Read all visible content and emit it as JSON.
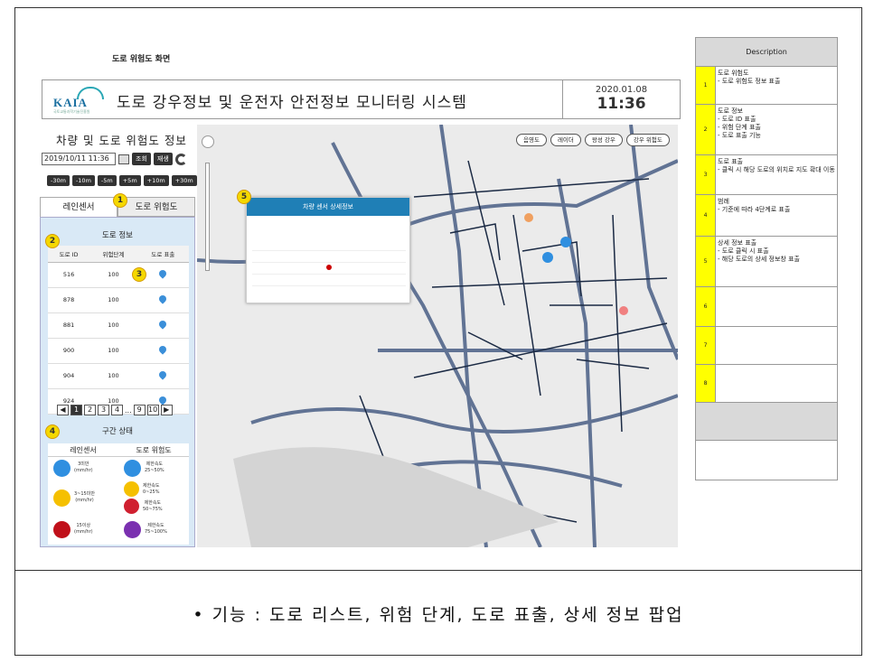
{
  "screen_title": "도로 위험도 화면",
  "header": {
    "logo_text": "KAIA",
    "logo_sub": "국토교통과학기술진흥원",
    "system_title": "도로 강우정보 및 운전자 안전정보 모니터링 시스템",
    "date": "2020.01.08",
    "time": "11:36"
  },
  "left_panel": {
    "title": "차량 및 도로 위험도 정보",
    "datetime": "2019/10/11 11:36",
    "query_btn": "조회",
    "play_btn": "재생",
    "offsets": [
      "-30m",
      "-10m",
      "-5m",
      "+5m",
      "+10m",
      "+30m"
    ],
    "tabs": [
      "레인센서",
      "도로 위험도"
    ],
    "road_info_title": "도로 정보",
    "table_headers": [
      "도로 ID",
      "위험단계",
      "도로 표출"
    ],
    "rows": [
      {
        "id": "516",
        "level": "100"
      },
      {
        "id": "878",
        "level": "100"
      },
      {
        "id": "881",
        "level": "100"
      },
      {
        "id": "900",
        "level": "100"
      },
      {
        "id": "904",
        "level": "100"
      },
      {
        "id": "924",
        "level": "100"
      }
    ],
    "pages": [
      "1",
      "2",
      "3",
      "4",
      "...",
      "9",
      "10"
    ],
    "section_status_title": "구간 상태",
    "legend_headers": [
      "레인센서",
      "도로 위험도"
    ],
    "legend_rain": [
      {
        "label": "3미만\n(mm/hr)",
        "color": "#2f8fe0"
      },
      {
        "label": "3~15미만\n(mm/hr)",
        "color": "#f5c000"
      },
      {
        "label": "15이상\n(mm/hr)",
        "color": "#c0101a"
      }
    ],
    "legend_risk": [
      {
        "label": "제한속도\n25~50%",
        "color": "#2f8fe0"
      },
      {
        "label": "제한속도\n0~25%",
        "color": "#f5c000"
      },
      {
        "label": "제한속도\n50~75%",
        "color": "#d02030"
      },
      {
        "label": "제한속도\n75~100%",
        "color": "#7a30b0"
      }
    ]
  },
  "map": {
    "buttons": [
      "음영도",
      "레이더",
      "왕성 강우",
      "강우 위험도"
    ],
    "popup_title": "차량 센서 상세정보"
  },
  "badges": [
    "1",
    "2",
    "3",
    "4",
    "5"
  ],
  "description": {
    "header": "Description",
    "rows": [
      {
        "num": "1",
        "text": "도로 위험도\n- 도로 위험도 정보 표출"
      },
      {
        "num": "2",
        "text": "도로 정보\n- 도로 ID 표출\n- 위험 단계 표출\n- 도로 표출 기능"
      },
      {
        "num": "3",
        "text": "도로 표출\n- 클릭 시 해당 도로의 위치로 지도 확대 이동"
      },
      {
        "num": "4",
        "text": "범례\n- 기준에 따라 4단계로 표출"
      },
      {
        "num": "5",
        "text": "상세 정보 표출\n- 도로 클릭 시 표출\n- 해당 도로의 상세 정보창 표출"
      },
      {
        "num": "6",
        "text": ""
      },
      {
        "num": "7",
        "text": ""
      },
      {
        "num": "8",
        "text": ""
      }
    ]
  },
  "footer": "• 기능 : 도로 리스트, 위험 단계, 도로 표출, 상세 정보 팝업"
}
